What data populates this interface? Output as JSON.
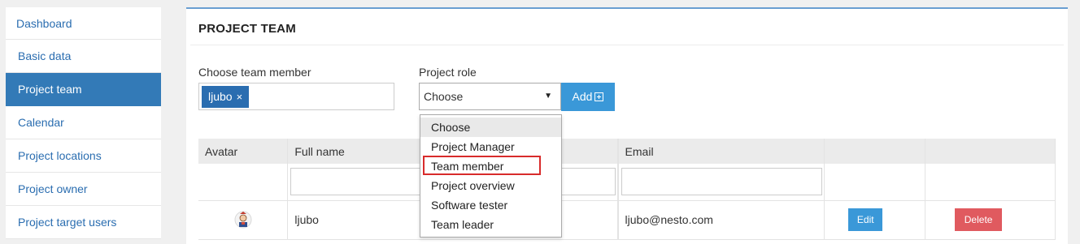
{
  "sidebar": {
    "items": [
      {
        "label": "Dashboard",
        "active": false
      },
      {
        "label": "Basic data",
        "active": false
      },
      {
        "label": "Project team",
        "active": true
      },
      {
        "label": "Calendar",
        "active": false
      },
      {
        "label": "Project locations",
        "active": false
      },
      {
        "label": "Project owner",
        "active": false
      },
      {
        "label": "Project target users",
        "active": false
      }
    ]
  },
  "panel": {
    "title": "PROJECT TEAM",
    "member_label": "Choose team member",
    "member_tag": "ljubo",
    "member_tag_remove": "×",
    "role_label": "Project role",
    "role_selected": "Choose",
    "role_arrow": "▼",
    "add_label": "Add",
    "role_options": [
      "Choose",
      "Project Manager",
      "Team member",
      "Project overview",
      "Software tester",
      "Team leader"
    ],
    "highlighted_option": "Team member"
  },
  "table": {
    "headers": [
      "Avatar",
      "Full name",
      "",
      "Email",
      "",
      ""
    ],
    "rows": [
      {
        "avatar": "avatar-image",
        "full_name": "ljubo",
        "email": "ljubo@nesto.com",
        "edit_label": "Edit",
        "delete_label": "Delete"
      }
    ]
  },
  "colors": {
    "accent": "#337ab7",
    "button_blue": "#3a98d8",
    "delete_red": "#e05a5f",
    "highlight_red": "#d82b2b"
  }
}
